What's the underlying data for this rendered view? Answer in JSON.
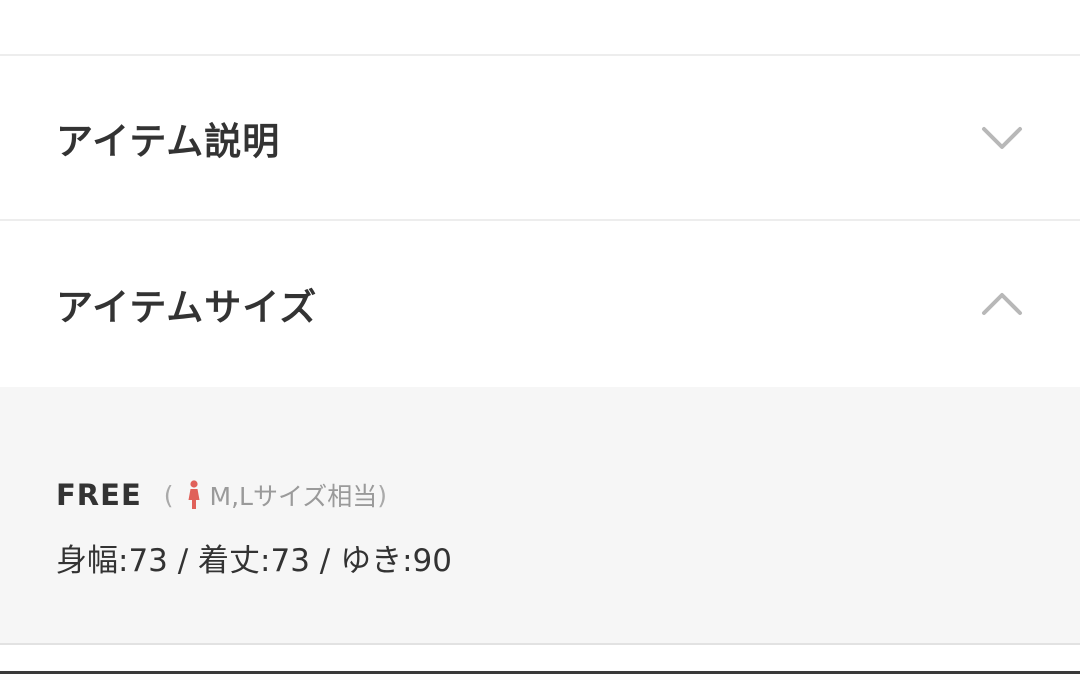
{
  "sections": {
    "description": {
      "title": "アイテム説明",
      "state": "collapsed",
      "icon": "chevron-down-icon"
    },
    "size": {
      "title": "アイテムサイズ",
      "state": "expanded",
      "icon": "chevron-up-icon",
      "size_name": "FREE",
      "note_open": "(",
      "note_text": "M,Lサイズ相当",
      "note_close": ")",
      "gender_icon": "woman-icon",
      "gender_icon_color": "#e0615a",
      "measurements": "身幅:73 / 着丈:73 / ゆき:90"
    }
  },
  "colors": {
    "panel_background": "#f6f6f6",
    "chevron": "#b8b8b8"
  }
}
